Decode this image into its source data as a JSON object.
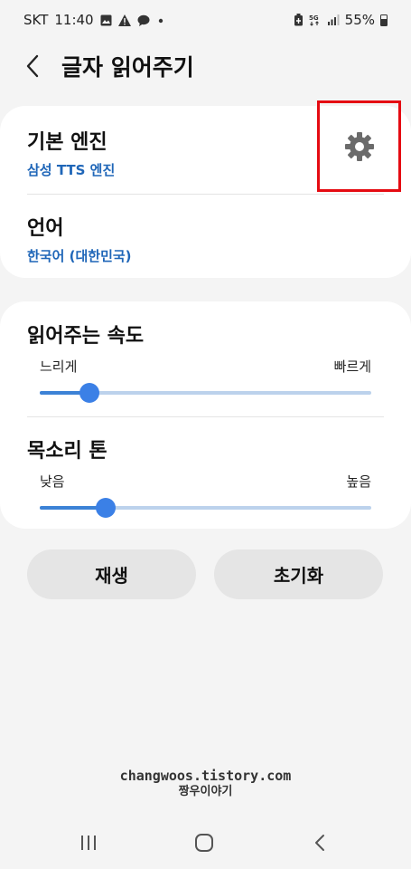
{
  "status_bar": {
    "carrier": "SKT",
    "time": "11:40",
    "battery": "55%",
    "icons": [
      "image-icon",
      "warning-icon",
      "chat-icon",
      "dot-icon",
      "battery-saver-icon",
      "5g-icon",
      "signal-icon",
      "battery-icon"
    ]
  },
  "header": {
    "title": "글자 읽어주기"
  },
  "engine": {
    "title": "기본 엔진",
    "value": "삼성 TTS 엔진"
  },
  "language": {
    "title": "언어",
    "value": "한국어 (대한민국)"
  },
  "speech_rate": {
    "title": "읽어주는 속도",
    "min_label": "느리게",
    "max_label": "빠르게",
    "value": 0.15
  },
  "pitch": {
    "title": "목소리 톤",
    "min_label": "낮음",
    "max_label": "높음",
    "value": 0.2
  },
  "buttons": {
    "play": "재생",
    "reset": "초기화"
  },
  "watermark": {
    "line1": "changwoos.tistory.com",
    "line2": "짱우이야기"
  },
  "colors": {
    "accent": "#3b80e6",
    "link": "#1f66b8",
    "highlight_box": "#e50b12",
    "track": "#bcd2ec"
  }
}
